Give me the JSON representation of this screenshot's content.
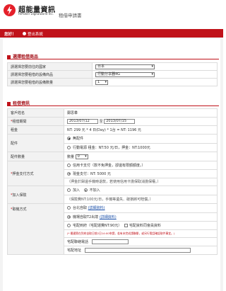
{
  "header": {
    "brand": "超能量資訊",
    "brand_en": "HiPower Digitalworld Inc.",
    "subtitle": "租借申請書"
  },
  "nav": {
    "hello": "您好！",
    "logout": "登出系統"
  },
  "section1": {
    "title": "選擇租借商品",
    "rows": [
      {
        "label": "請選擇您要前往的國家",
        "value": "日本"
      },
      {
        "label": "請選擇您要租借的設備商品",
        "value": "行動分享器4G"
      },
      {
        "label": "請選擇您要租借的設備數量",
        "value": "1"
      }
    ]
  },
  "section2": {
    "title": "租借資訊",
    "customer": {
      "label": "客戶姓名",
      "value": "鄭思羣"
    },
    "period": {
      "label": "租借期間",
      "start": "2013/07/12",
      "to": "至",
      "end": "2013/07/15"
    },
    "rent": {
      "label": "租金",
      "value": "NT: 299 元 * 4 日(Day) * 1台 = NT: 1196 元"
    },
    "accessory": {
      "label": "配件",
      "opt1": "無配件",
      "opt2": "行動電源 租金：NT:50 元/日，押金：NT:1000元"
    },
    "acc_qty": {
      "label": "配件數量",
      "prefix": "數量",
      "value": "0"
    },
    "deposit": {
      "label": "押金支付方式",
      "opt1": "信用卡支付（款不免押金，卻還有限額額度。）",
      "opt2": "現金支付：NT: 5000 元",
      "note": "（押金於歸還手機時退款，若使用信用卡擔保取消擔保權。）"
    },
    "insurance": {
      "label": "加入保險",
      "opt_yes": "加入",
      "opt_no": "不加入",
      "note": "（保險費NT:100元/日，手機等遺失、破損將可賠償。）"
    },
    "pickup": {
      "label": "取機方式",
      "opt1": "台北自取",
      "opt1_link": "(詳細資料)",
      "opt2": "機場自取T2出境",
      "opt2_link": "(詳細資料)",
      "opt3": "宅配到府（宅配運費NT:90元）",
      "opt3_extra": "宅配資料同會員資料",
      "warning": "(* 最遲需在到府自取日前2日14:00申請，若有未完成請聯繫，或另行電話確認取件事宜。)",
      "phone_label": "宅配聯絡電話",
      "address_label": "宅配地址"
    }
  }
}
